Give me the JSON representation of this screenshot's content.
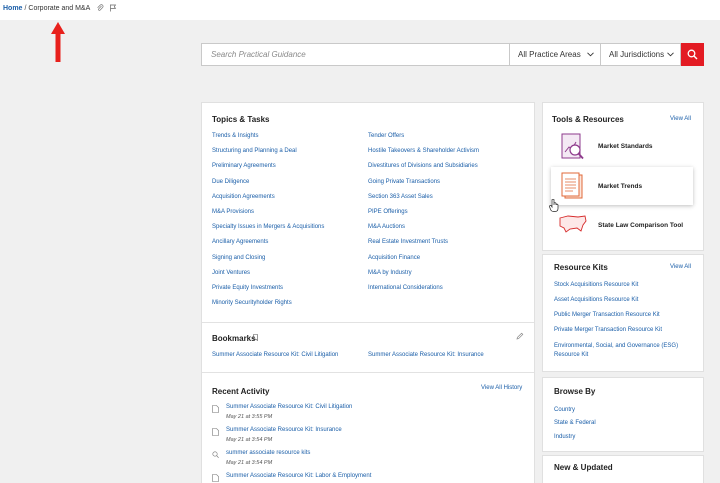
{
  "breadcrumb": {
    "home": "Home",
    "separator": "/",
    "current": "Corporate and M&A"
  },
  "search": {
    "placeholder": "Search Practical Guidance",
    "practice_areas": "All Practice Areas",
    "jurisdictions": "All Jurisdictions"
  },
  "topics": {
    "title": "Topics & Tasks",
    "col1": [
      "Trends & Insights",
      "Structuring and Planning a Deal",
      "Preliminary Agreements",
      "Due Diligence",
      "Acquisition Agreements",
      "M&A Provisions",
      "Specialty Issues in Mergers & Acquisitions",
      "Ancillary Agreements",
      "Signing and Closing",
      "Joint Ventures",
      "Private Equity Investments",
      "Minority Securityholder Rights"
    ],
    "col2": [
      "Tender Offers",
      "Hostile Takeovers & Shareholder Activism",
      "Divestitures of Divisions and Subsidiaries",
      "Going Private Transactions",
      "Section 363 Asset Sales",
      "PIPE Offerings",
      "M&A Auctions",
      "Real Estate Investment Trusts",
      "Acquisition Finance",
      "M&A by Industry",
      "International Considerations"
    ]
  },
  "bookmarks": {
    "title": "Bookmarks",
    "items": [
      "Summer Associate Resource Kit: Civil Litigation",
      "Summer Associate Resource Kit: Insurance"
    ]
  },
  "recent": {
    "title": "Recent Activity",
    "view_all": "View All History",
    "items": [
      {
        "title": "Summer Associate Resource Kit: Civil Litigation",
        "date": "May 21 at 3:55 PM",
        "icon": "document-icon"
      },
      {
        "title": "Summer Associate Resource Kit: Insurance",
        "date": "May 21 at 3:54 PM",
        "icon": "document-icon"
      },
      {
        "title": "summer associate resource kits",
        "date": "May 21 at 3:54 PM",
        "icon": "search-icon"
      },
      {
        "title": "Summer Associate Resource Kit: Labor & Employment",
        "date": "",
        "icon": "document-icon"
      }
    ]
  },
  "tools": {
    "title": "Tools & Resources",
    "view_all": "View All",
    "items": [
      "Market Standards",
      "Market Trends",
      "State Law Comparison Tool"
    ]
  },
  "kits": {
    "title": "Resource Kits",
    "view_all": "View All",
    "items": [
      "Stock Acquisitions Resource Kit",
      "Asset Acquisitions Resource Kit",
      "Public Merger Transaction Resource Kit",
      "Private Merger Transaction Resource Kit",
      "Environmental, Social, and Governance (ESG)",
      "Resource Kit"
    ]
  },
  "browse": {
    "title": "Browse By",
    "items": [
      "Country",
      "State & Federal",
      "Industry"
    ]
  },
  "news": {
    "title": "New & Updated"
  },
  "colors": {
    "link": "#1a5ea8",
    "accent": "#e31b23",
    "tool_icon": "#8e3a8c",
    "tool_icon2": "#e06a3a"
  }
}
